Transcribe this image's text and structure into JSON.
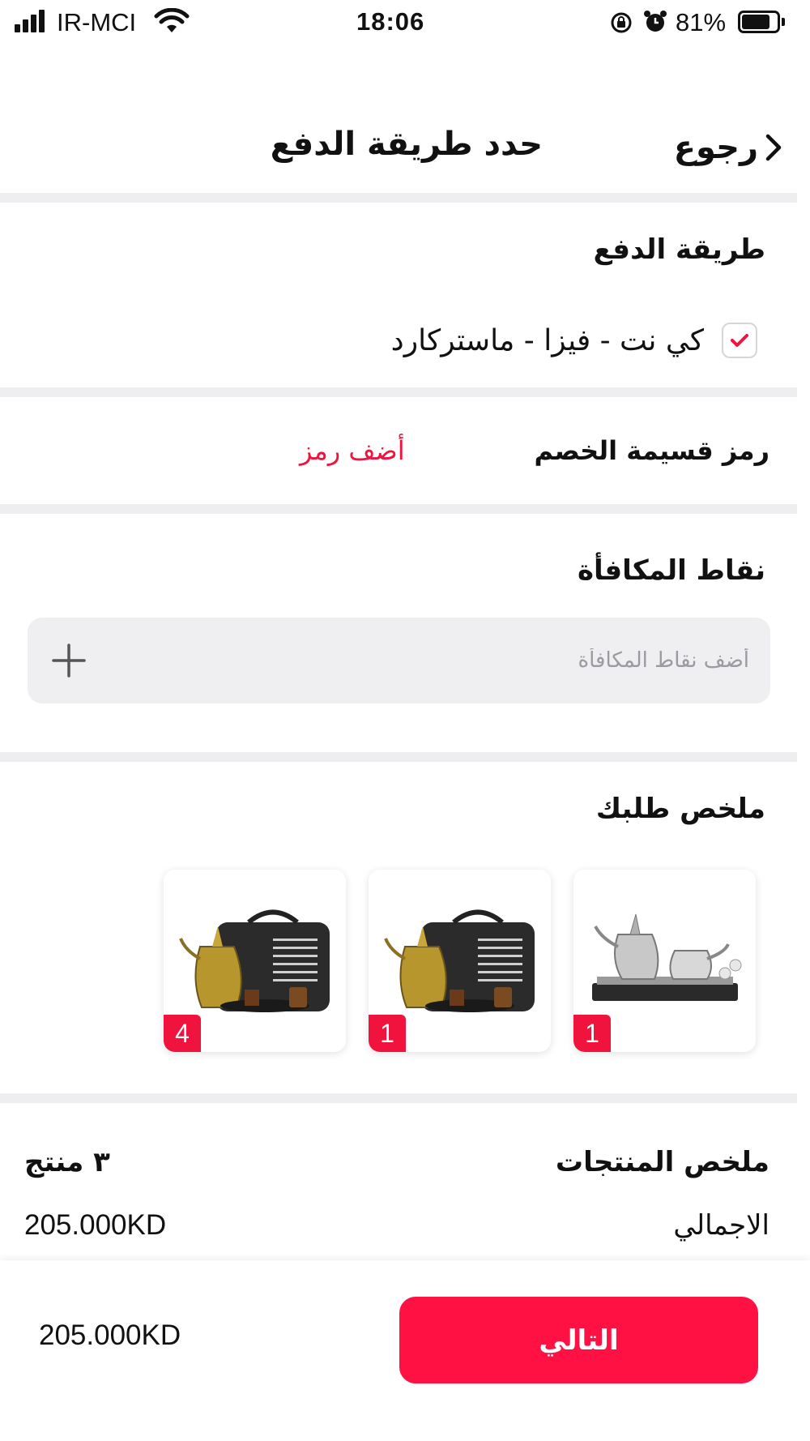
{
  "status_bar": {
    "carrier": "IR-MCI",
    "time": "18:06",
    "battery_percent": "81%",
    "battery_level": 0.81,
    "icons": [
      "signal-icon",
      "wifi-icon",
      "rotation-lock-icon",
      "alarm-icon",
      "battery-icon"
    ]
  },
  "header": {
    "title": "حدد طريقة الدفع",
    "back_label": "رجوع"
  },
  "payment": {
    "title": "طريقة الدفع",
    "option_label": "كي نت - فيزا - ماستركارد",
    "option_checked": true
  },
  "coupon": {
    "label": "رمز قسيمة الخصم",
    "add_label": "أضف رمز"
  },
  "reward": {
    "title": "نقاط المكافأة",
    "placeholder": "أضف نقاط المكافأة",
    "value": ""
  },
  "order": {
    "title": "ملخص طلبك",
    "products": [
      {
        "quantity": "1",
        "image": "dallah-teapot-tray-set"
      },
      {
        "quantity": "1",
        "image": "coffee-bag-set"
      },
      {
        "quantity": "4",
        "image": "coffee-bag-set"
      }
    ]
  },
  "summary": {
    "title": "ملخص المنتجات",
    "count": "٣ منتج",
    "total_label": "الاجمالي",
    "total_value": "205.000KD"
  },
  "footer": {
    "total": "205.000KD",
    "next_label": "التالي"
  },
  "colors": {
    "accent": "#f0133e",
    "button": "#ff1144",
    "divider": "#eeeef0",
    "input_bg": "#efeff1"
  }
}
